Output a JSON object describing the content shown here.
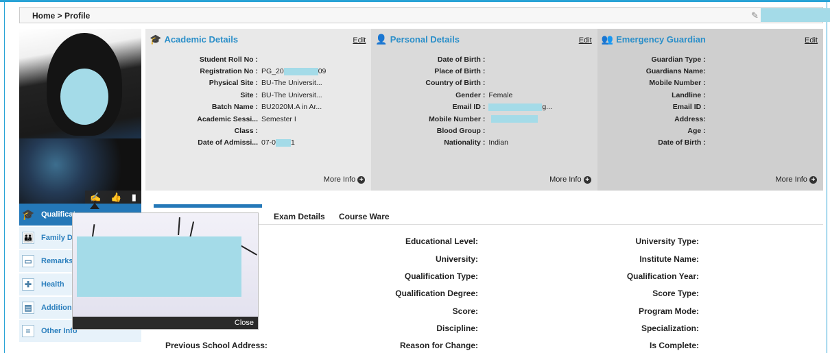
{
  "breadcrumb": "Home > Profile",
  "academic": {
    "title": "Academic Details",
    "edit": "Edit",
    "more": "More Info",
    "rows": [
      {
        "label": "Student Roll No :",
        "value": ""
      },
      {
        "label": "Registration No :",
        "value": "PG_20",
        "value_tail": "09"
      },
      {
        "label": "Physical Site :",
        "value": "BU-The Universit..."
      },
      {
        "label": "Site :",
        "value": "BU-The Universit..."
      },
      {
        "label": "Batch Name :",
        "value": "BU2020M.A in Ar..."
      },
      {
        "label": "Academic Sessi...",
        "value": "Semester I"
      },
      {
        "label": "Class :",
        "value": ""
      },
      {
        "label": "Date of Admissi...",
        "value": "07-0",
        "value_tail": "1"
      }
    ]
  },
  "personal": {
    "title": "Personal Details",
    "edit": "Edit",
    "more": "More Info",
    "rows": [
      {
        "label": "Date of Birth :",
        "value": ""
      },
      {
        "label": "Place of Birth :",
        "value": ""
      },
      {
        "label": "Country of Birth :",
        "value": ""
      },
      {
        "label": "Gender :",
        "value": "Female"
      },
      {
        "label": "Email ID :",
        "value": "",
        "value_tail": "g..."
      },
      {
        "label": "Mobile Number :",
        "value": ""
      },
      {
        "label": "Blood Group :",
        "value": ""
      },
      {
        "label": "Nationality :",
        "value": "Indian"
      }
    ]
  },
  "guardian": {
    "title": "Emergency Guardian",
    "edit": "Edit",
    "more": "More Info",
    "rows": [
      {
        "label": "Guardian Type :",
        "value": ""
      },
      {
        "label": "Guardians Name:",
        "value": ""
      },
      {
        "label": "Mobile Number :",
        "value": ""
      },
      {
        "label": "Landline :",
        "value": ""
      },
      {
        "label": "Email ID :",
        "value": ""
      },
      {
        "label": "Address:",
        "value": ""
      },
      {
        "label": "Age :",
        "value": ""
      },
      {
        "label": "Date of Birth :",
        "value": ""
      }
    ]
  },
  "sidebar": {
    "items": [
      {
        "label": "Qualificat"
      },
      {
        "label": "Family De"
      },
      {
        "label": "Remarks"
      },
      {
        "label": "Health"
      },
      {
        "label": "Additiona"
      },
      {
        "label": "Other Info"
      }
    ]
  },
  "tabs": {
    "exam": "Exam Details",
    "course": "Course Ware"
  },
  "details": {
    "col2": [
      "Educational Level:",
      "University:",
      "Qualification Type:",
      "Qualification Degree:",
      "Score:",
      "Discipline:",
      "Reason for Change:"
    ],
    "col3": [
      "University Type:",
      "Institute Name:",
      "Qualification Year:",
      "Score Type:",
      "Program Mode:",
      "Specialization:",
      "Is Complete:"
    ],
    "col1_last": "Previous School Address:"
  },
  "popup": {
    "close": "Close"
  },
  "colors": {
    "accent": "#2478b8",
    "redaction": "#a4dbe8"
  }
}
